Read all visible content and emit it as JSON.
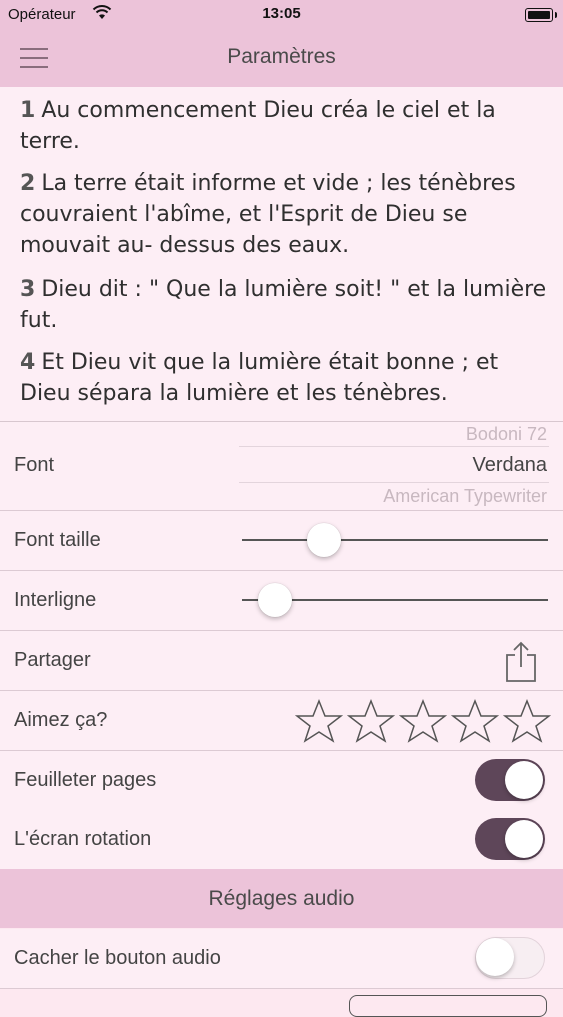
{
  "status": {
    "carrier": "Opérateur",
    "time": "13:05"
  },
  "nav": {
    "title": "Paramètres"
  },
  "verses": [
    {
      "num": "1",
      "text": "Au commencement Dieu créa le ciel et la terre."
    },
    {
      "num": "2",
      "text": "La terre était informe et vide ; les ténèbres couvraient l'abîme, et l'Esprit de Dieu se mouvait au- dessus des eaux."
    },
    {
      "num": "3",
      "text": "Dieu dit : \" Que la lumière soit! \" et la lumière fut."
    },
    {
      "num": "4",
      "text": "Et Dieu vit que la lumière était bonne ; et Dieu sépara la lumière et les ténèbres."
    }
  ],
  "settings": {
    "font": {
      "label": "Font",
      "options": [
        "Bodoni 72",
        "Verdana",
        "American Typewriter"
      ],
      "selected": "Verdana"
    },
    "font_size": {
      "label": "Font taille",
      "value": 0.24
    },
    "line_spacing": {
      "label": "Interligne",
      "value": 0.06
    },
    "share": {
      "label": "Partager"
    },
    "rating": {
      "label": "Aimez ça?",
      "stars": 5,
      "filled": 0
    },
    "page_flip": {
      "label": "Feuilleter pages",
      "on": true
    },
    "rotation": {
      "label": "L'écran rotation",
      "on": true
    }
  },
  "audio": {
    "header": "Réglages audio",
    "hide_button": {
      "label": "Cacher le bouton audio",
      "on": false
    }
  },
  "colors": {
    "nav_bg": "#ecc3d9",
    "content_bg": "#fdeef5",
    "toggle_on": "#5e4659"
  }
}
